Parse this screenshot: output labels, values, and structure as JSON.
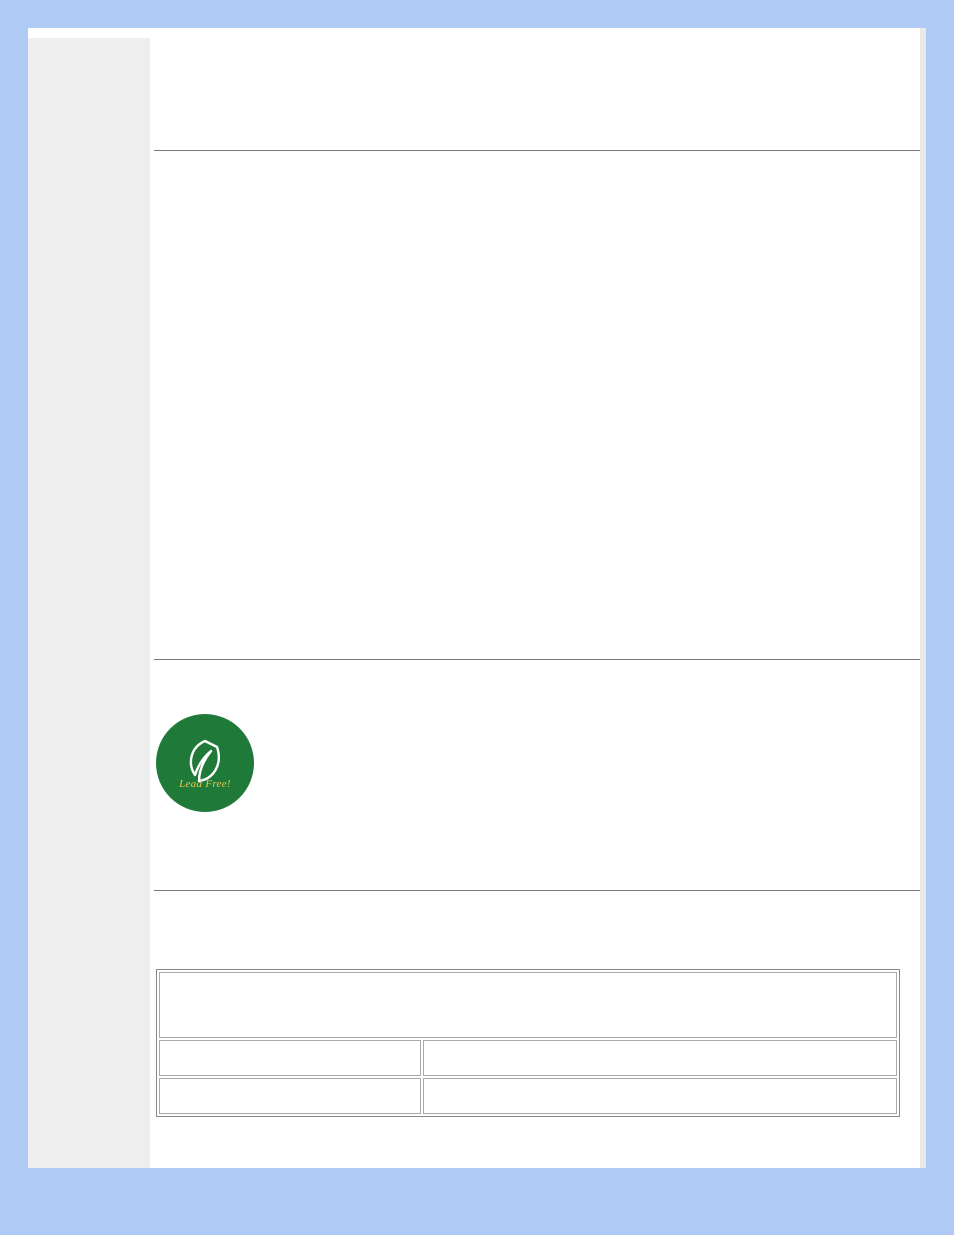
{
  "badge": {
    "label": "Lead Free!"
  },
  "table": {
    "header": "",
    "rows": [
      {
        "a": "",
        "b": ""
      },
      {
        "a": "",
        "b": ""
      }
    ]
  }
}
